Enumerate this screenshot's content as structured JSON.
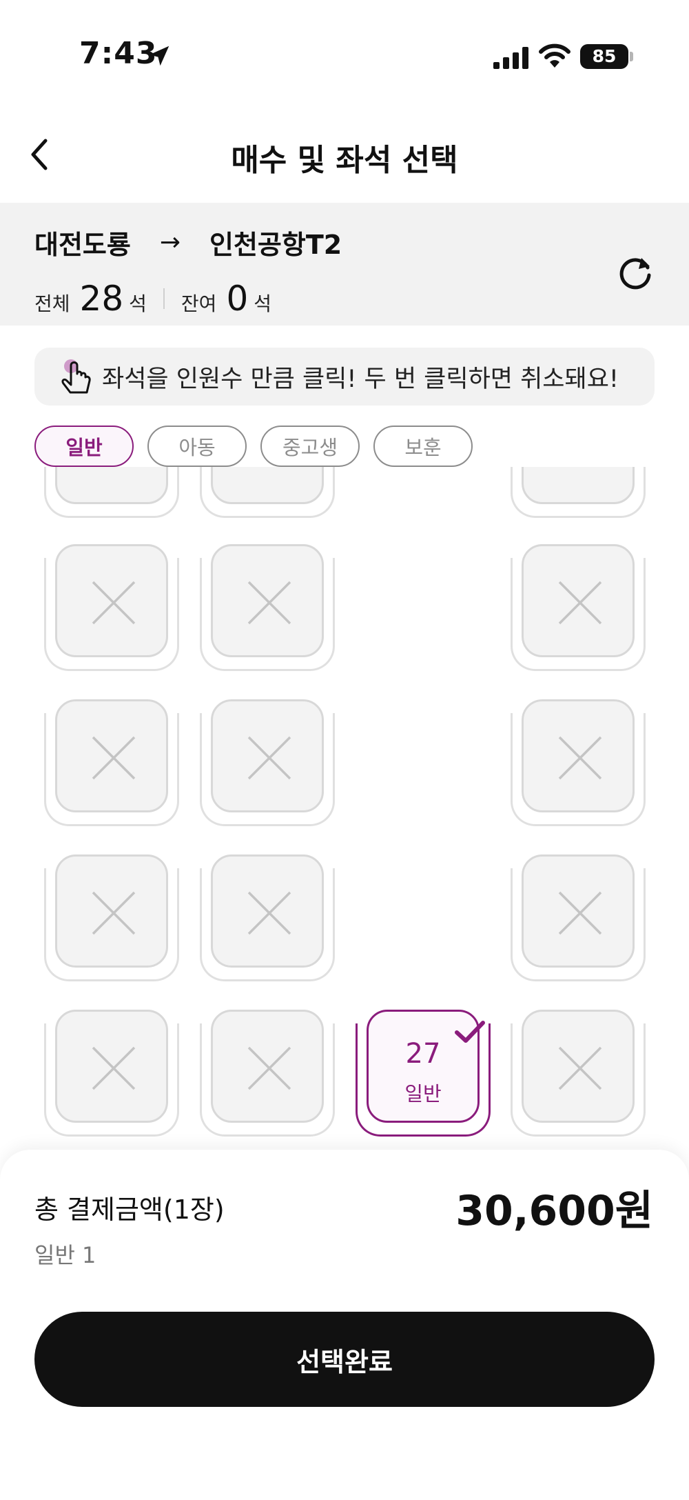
{
  "status_bar": {
    "time": "7:43",
    "battery": "85"
  },
  "header": {
    "title": "매수 및 좌석 선택"
  },
  "route": {
    "origin": "대전도룡",
    "arrow": "→",
    "destination": "인천공항T2",
    "total_label": "전체",
    "total_count": "28",
    "total_unit": "석",
    "remaining_label": "잔여",
    "remaining_count": "0",
    "remaining_unit": "석"
  },
  "notice": {
    "text": "좌석을 인원수 만큼 클릭! 두 번 클릭하면 취소돼요!"
  },
  "passenger_types": [
    {
      "label": "일반",
      "active": true
    },
    {
      "label": "아동",
      "active": false
    },
    {
      "label": "중고생",
      "active": false
    },
    {
      "label": "보훈",
      "active": false
    }
  ],
  "selected_seat": {
    "number": "27",
    "type": "일반"
  },
  "summary": {
    "total_label": "총 결제금액(1장)",
    "detail": "일반 1",
    "price": "30,600원"
  },
  "actions": {
    "complete_label": "선택완료"
  },
  "colors": {
    "accent": "#8a1c7c",
    "button": "#111111",
    "route_bg": "#f2f2f2"
  }
}
